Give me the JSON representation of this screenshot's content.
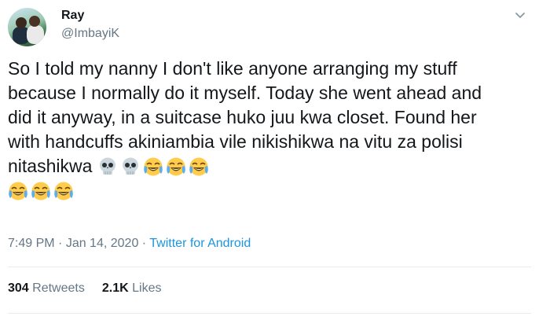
{
  "author": {
    "name": "Ray",
    "handle": "@ImbayiK"
  },
  "tweet": {
    "text": "So I told my nanny I don't like anyone arranging my stuff because I normally do it myself. Today she went ahead and did it anyway, in a suitcase huko juu kwa closet. Found her with handcuffs akiniambia vile nikishikwa na vitu za polisi nitashikwa",
    "emojis_line1": [
      "skull-emoji",
      "skull-emoji",
      "joy-emoji",
      "joy-emoji",
      "joy-emoji"
    ],
    "emojis_line2": [
      "joy-emoji",
      "joy-emoji",
      "joy-emoji"
    ]
  },
  "meta": {
    "time": "7:49 PM",
    "separator": " · ",
    "date": "Jan 14, 2020",
    "source": "Twitter for Android"
  },
  "stats": {
    "retweets_count": "304",
    "retweets_label": "Retweets",
    "likes_count": "2.1K",
    "likes_label": "Likes"
  },
  "colors": {
    "text": "#14171a",
    "secondary": "#657786",
    "link": "#1b95e0",
    "divider": "#e6ecf0"
  }
}
